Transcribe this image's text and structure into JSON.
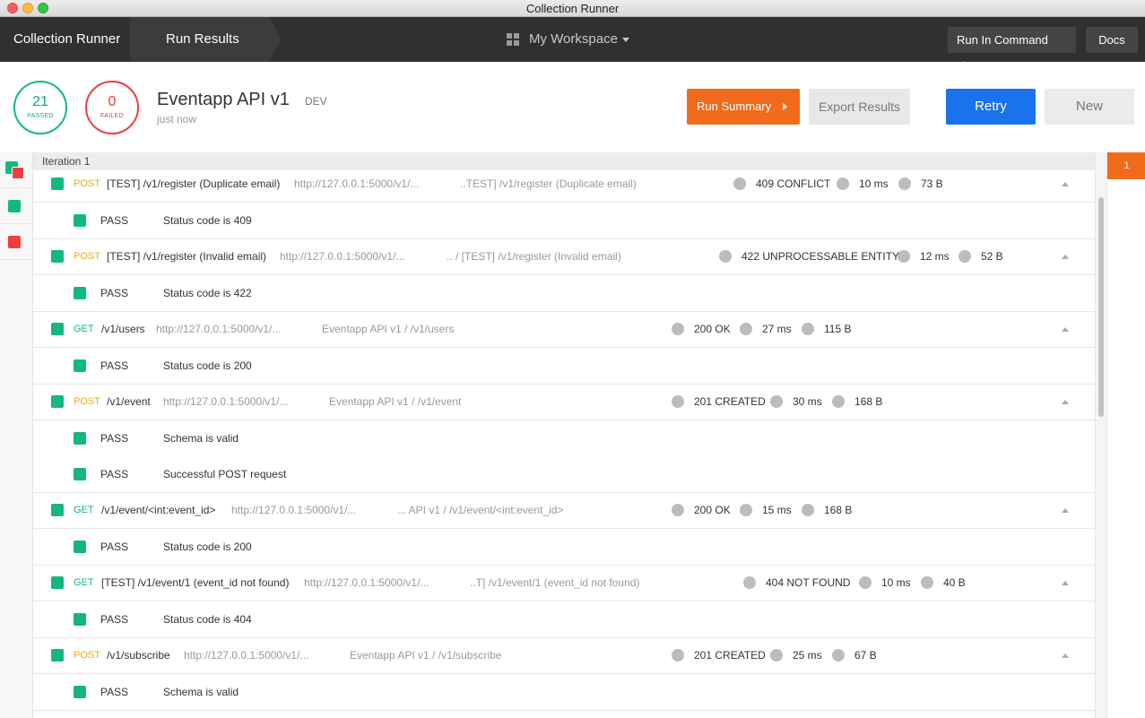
{
  "window": {
    "title": "Collection Runner"
  },
  "nav": {
    "crumb_runner": "Collection Runner",
    "crumb_results": "Run Results",
    "workspace": "My Workspace",
    "run_cli": "Run In Command Line",
    "docs": "Docs"
  },
  "summary": {
    "passed_count": "21",
    "passed_label": "PASSED",
    "failed_count": "0",
    "failed_label": "FAILED",
    "collection_name": "Eventapp API v1",
    "environment": "DEV",
    "timestamp": "just now",
    "run_summary": "Run Summary",
    "export_results": "Export Results",
    "retry": "Retry",
    "new": "New"
  },
  "iteration": {
    "label": "Iteration 1",
    "badge": "1"
  },
  "colors": {
    "pass": "#14b784",
    "fail": "#ef3f3f",
    "accent_orange": "#f26b1d",
    "retry_blue": "#1a73ea",
    "post": "#f0a90f",
    "get": "#14b784"
  },
  "requests": [
    {
      "method": "POST",
      "name": "[TEST] /v1/register (Duplicate email)",
      "url": "http://127.0.0.1:5000/v1/...",
      "path": "..TEST] /v1/register (Duplicate email)",
      "status": "409 CONFLICT",
      "time": "10 ms",
      "size": "73 B",
      "tests": [
        {
          "result": "PASS",
          "name": "Status code is 409"
        }
      ]
    },
    {
      "method": "POST",
      "name": "[TEST] /v1/register (Invalid email)",
      "url": "http://127.0.0.1:5000/v1/...",
      "path": ".. / [TEST] /v1/register (Invalid email)",
      "status": "422 UNPROCESSABLE ENTITY",
      "time": "12 ms",
      "size": "52 B",
      "tests": [
        {
          "result": "PASS",
          "name": "Status code is 422"
        }
      ]
    },
    {
      "method": "GET",
      "name": "/v1/users",
      "url": "http://127.0.0.1:5000/v1/...",
      "path": "Eventapp API v1 / /v1/users",
      "status": "200 OK",
      "time": "27 ms",
      "size": "115 B",
      "tests": [
        {
          "result": "PASS",
          "name": "Status code is 200"
        }
      ]
    },
    {
      "method": "POST",
      "name": "/v1/event",
      "url": "http://127.0.0.1:5000/v1/...",
      "path": "Eventapp API v1 / /v1/event",
      "status": "201 CREATED",
      "time": "30 ms",
      "size": "168 B",
      "tests": [
        {
          "result": "PASS",
          "name": "Schema is valid"
        },
        {
          "result": "PASS",
          "name": "Successful POST request"
        }
      ]
    },
    {
      "method": "GET",
      "name": "/v1/event/<int:event_id>",
      "url": "http://127.0.0.1:5000/v1/...",
      "path": "... API v1 / /v1/event/<int:event_id>",
      "status": "200 OK",
      "time": "15 ms",
      "size": "168 B",
      "tests": [
        {
          "result": "PASS",
          "name": "Status code is 200"
        }
      ]
    },
    {
      "method": "GET",
      "name": "[TEST] /v1/event/1 (event_id not found)",
      "url": "http://127.0.0.1:5000/v1/...",
      "path": "..T] /v1/event/1 (event_id not found)",
      "status": "404 NOT FOUND",
      "time": "10 ms",
      "size": "40 B",
      "tests": [
        {
          "result": "PASS",
          "name": "Status code is 404"
        }
      ]
    },
    {
      "method": "POST",
      "name": "/v1/subscribe",
      "url": "http://127.0.0.1:5000/v1/...",
      "path": "Eventapp API v1 / /v1/subscribe",
      "status": "201 CREATED",
      "time": "25 ms",
      "size": "67 B",
      "tests": [
        {
          "result": "PASS",
          "name": "Schema is valid"
        }
      ]
    }
  ]
}
